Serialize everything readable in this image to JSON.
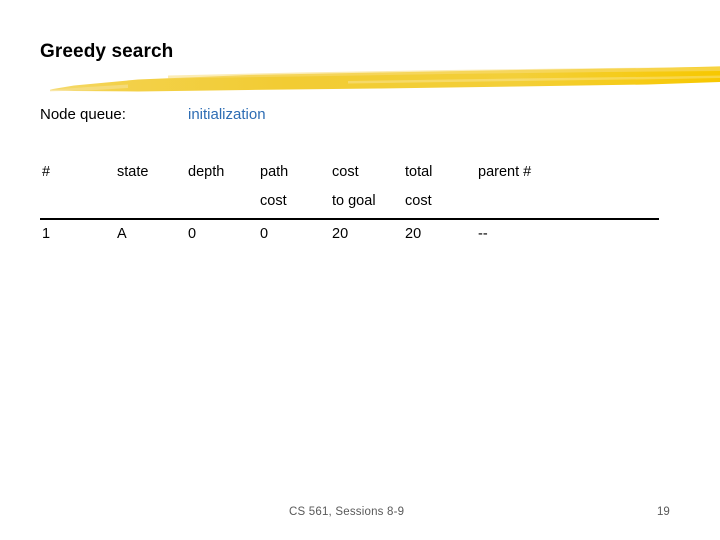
{
  "slide": {
    "title": "Greedy search",
    "accent_color": "#f2cc33",
    "link_color": "#2e6db4",
    "text_color": "#000000",
    "footer_color": "#595959",
    "background_color": "#ffffff"
  },
  "queue": {
    "label": "Node queue:",
    "value": "initialization"
  },
  "table": {
    "headers_line1": [
      "#",
      "state",
      "depth",
      "path",
      "cost",
      "total",
      "parent #"
    ],
    "headers_line2": [
      "",
      "",
      "",
      "cost",
      "to goal",
      "cost",
      ""
    ],
    "rows": [
      [
        "1",
        "A",
        "0",
        "0",
        "20",
        "20",
        "--"
      ]
    ]
  },
  "footer": {
    "center": "CS 561,  Sessions 8-9",
    "page": "19"
  }
}
